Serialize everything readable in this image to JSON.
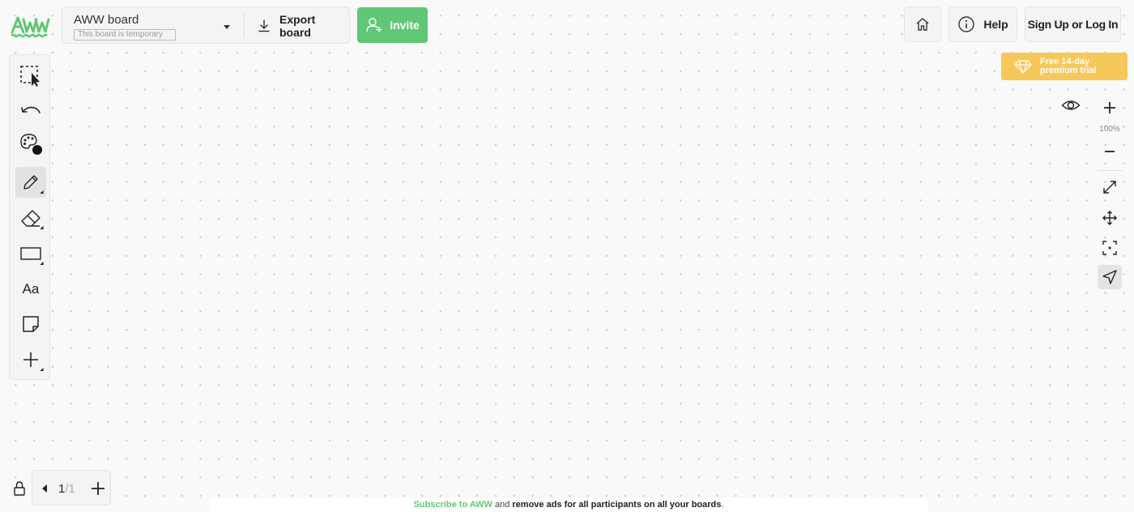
{
  "app": {
    "logo_text": "AWW",
    "brand_color": "#5fc776"
  },
  "board": {
    "name": "AWW board",
    "temporary_label": "This board is temporary",
    "export_label": "Export board",
    "invite_label": "Invite"
  },
  "header": {
    "home_icon": "home-icon",
    "help_label": "Help",
    "login_label": "Sign Up or Log In"
  },
  "promo": {
    "trial_label": "Free 14-day premium trial",
    "color": "#f6c85a"
  },
  "toolbar": {
    "tools": [
      {
        "name": "select",
        "icon": "select-icon"
      },
      {
        "name": "undo",
        "icon": "undo-icon"
      },
      {
        "name": "color",
        "icon": "palette-icon"
      },
      {
        "name": "pen",
        "icon": "pencil-icon",
        "active": true
      },
      {
        "name": "eraser",
        "icon": "eraser-icon"
      },
      {
        "name": "shape",
        "icon": "rectangle-icon"
      },
      {
        "name": "text",
        "icon": "text-icon",
        "label": "Aa"
      },
      {
        "name": "sticky",
        "icon": "sticky-note-icon"
      },
      {
        "name": "more",
        "icon": "plus-icon"
      }
    ]
  },
  "zoom": {
    "level": "100%",
    "controls": [
      "view-icon",
      "zoom-in-icon",
      "zoom-out-icon",
      "fit-icon",
      "pan-icon",
      "center-icon",
      "navigate-icon"
    ]
  },
  "pages": {
    "current": "1",
    "separator": "/",
    "total": "1"
  },
  "footer": {
    "link_text": "Subscribe to AWW",
    "middle_text": " and ",
    "bold_text": "remove ads for all participants on all your boards",
    "end_text": "."
  }
}
